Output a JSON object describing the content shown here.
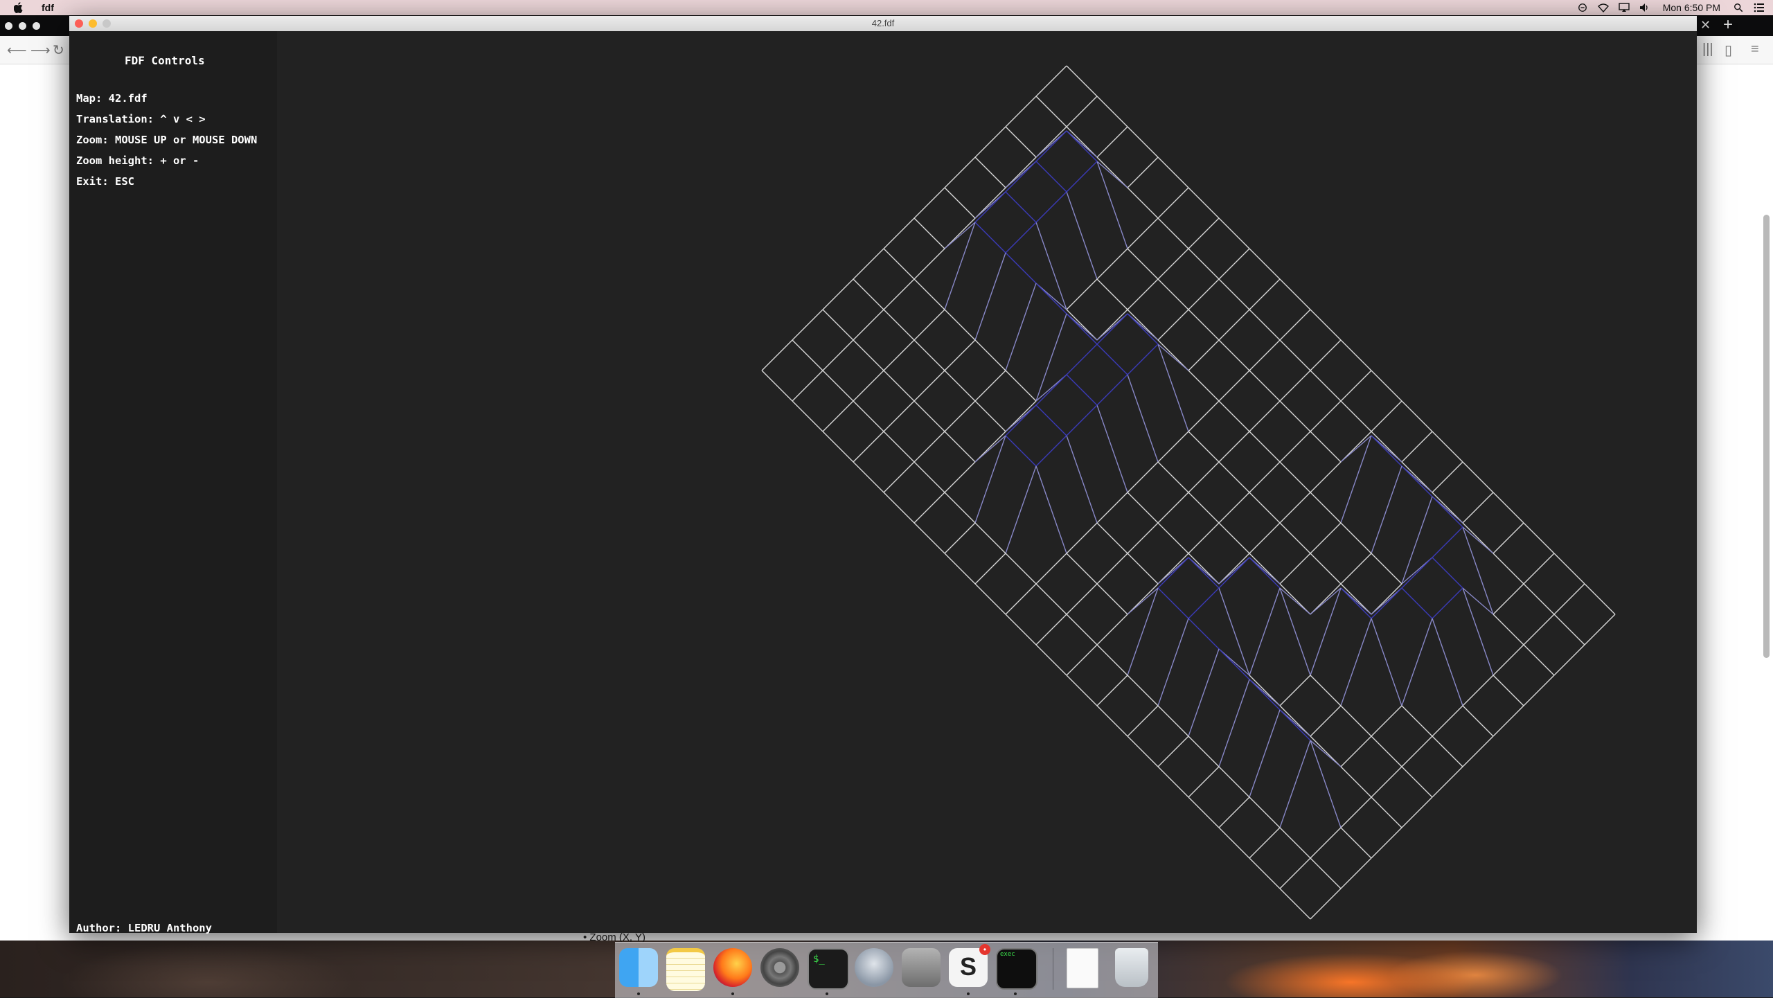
{
  "menubar": {
    "app_name": "fdf",
    "clock": "Mon 6:50 PM"
  },
  "fdf_window": {
    "title": "42.fdf",
    "panel": {
      "heading": "FDF Controls",
      "lines": [
        "Map: 42.fdf",
        "Translation: ^ v < >",
        "Zoom: MOUSE UP or MOUSE DOWN",
        "Zoom height: + or -",
        "Exit: ESC"
      ],
      "author": "Author: LEDRU Anthony"
    }
  },
  "browser": {
    "peek_text": "• Zoom (X, Y)"
  },
  "dock": {
    "items": [
      "Finder",
      "Notes",
      "Firefox",
      "System Preferences",
      "Terminal",
      "Launchpad",
      "Calculator",
      "Slack",
      "exec",
      "Document",
      "Trash"
    ],
    "slack_badge": "•"
  },
  "colors": {
    "grid_line": "#d6d6d6",
    "grid_high": "#3a3ab8",
    "canvas_bg": "#222222"
  }
}
